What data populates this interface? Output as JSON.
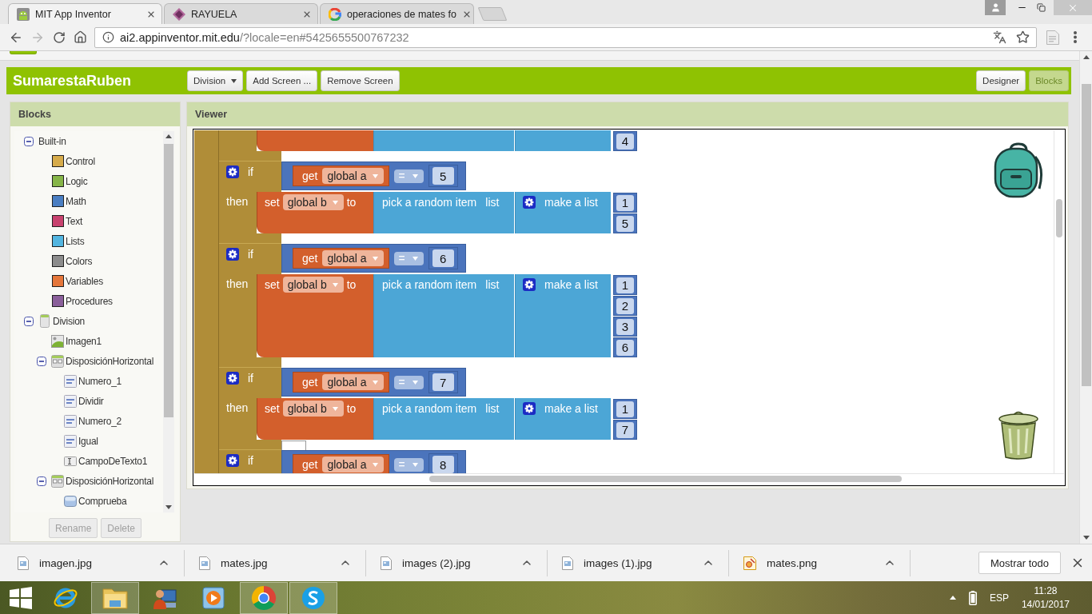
{
  "browser": {
    "tabs": [
      {
        "title": "MIT App Inventor",
        "kind": "app",
        "selected": true
      },
      {
        "title": "RAYUELA",
        "kind": "site",
        "selected": false
      },
      {
        "title": "operaciones de mates fo",
        "kind": "search",
        "selected": false
      }
    ],
    "address": {
      "host": "ai2.appinventor.mit.edu",
      "path": "/?locale=en#5425655500767232"
    }
  },
  "app": {
    "project_title": "SumarestaRuben",
    "screen_dropdown": "Division",
    "screen_buttons": [
      "Add Screen ...",
      "Remove Screen"
    ],
    "view_buttons": [
      {
        "label": "Designer",
        "selected": false
      },
      {
        "label": "Blocks",
        "selected": true
      }
    ]
  },
  "blocks_panel": {
    "title": "Blocks",
    "tree": [
      {
        "label": "Built-in",
        "kind": "group",
        "expanded": true,
        "children": [
          {
            "label": "Control",
            "kind": "category",
            "color": "#d6ab4a"
          },
          {
            "label": "Logic",
            "kind": "category",
            "color": "#86b548"
          },
          {
            "label": "Math",
            "kind": "category",
            "color": "#4a7ec2"
          },
          {
            "label": "Text",
            "kind": "category",
            "color": "#c8426e"
          },
          {
            "label": "Lists",
            "kind": "category",
            "color": "#52b5e0"
          },
          {
            "label": "Colors",
            "kind": "category",
            "color": "#8c8c8c"
          },
          {
            "label": "Variables",
            "kind": "category",
            "color": "#e5763a"
          },
          {
            "label": "Procedures",
            "kind": "category",
            "color": "#8a5f9a"
          }
        ]
      },
      {
        "label": "Division",
        "kind": "screen",
        "expanded": true,
        "children": [
          {
            "label": "Imagen1",
            "kind": "image"
          },
          {
            "label": "DisposiciónHorizontal",
            "kind": "arrangement",
            "expanded": true,
            "children": [
              {
                "label": "Numero_1",
                "kind": "label"
              },
              {
                "label": "Dividir",
                "kind": "label"
              },
              {
                "label": "Numero_2",
                "kind": "label"
              },
              {
                "label": "Igual",
                "kind": "label"
              },
              {
                "label": "CampoDeTexto1",
                "kind": "textbox"
              }
            ]
          },
          {
            "label": "DisposiciónHorizontal",
            "kind": "arrangement",
            "expanded": true,
            "children": [
              {
                "label": "Comprueba",
                "kind": "button"
              }
            ]
          }
        ]
      }
    ],
    "buttons": [
      {
        "label": "Rename",
        "disabled": true
      },
      {
        "label": "Delete",
        "disabled": true
      }
    ]
  },
  "viewer": {
    "title": "Viewer",
    "cut_off_block": {
      "items": [
        "4"
      ]
    },
    "if_blocks": [
      {
        "if_label": "if",
        "condition": {
          "get": "get",
          "variable": "global a",
          "operator": "=",
          "value": "5"
        },
        "then_label": "then",
        "action": {
          "set": "set",
          "variable": "global b",
          "to": "to",
          "pick": "pick a random item",
          "list": "list",
          "make": "make a list",
          "items": [
            "1",
            "5"
          ]
        }
      },
      {
        "if_label": "if",
        "condition": {
          "get": "get",
          "variable": "global a",
          "operator": "=",
          "value": "6"
        },
        "then_label": "then",
        "action": {
          "set": "set",
          "variable": "global b",
          "to": "to",
          "pick": "pick a random item",
          "list": "list",
          "make": "make a list",
          "items": [
            "1",
            "2",
            "3",
            "6"
          ]
        }
      },
      {
        "if_label": "if",
        "condition": {
          "get": "get",
          "variable": "global a",
          "operator": "=",
          "value": "7"
        },
        "then_label": "then",
        "action": {
          "set": "set",
          "variable": "global b",
          "to": "to",
          "pick": "pick a random item",
          "list": "list",
          "make": "make a list",
          "items": [
            "1",
            "7"
          ]
        }
      },
      {
        "if_label": "if",
        "condition": {
          "get": "get",
          "variable": "global a",
          "operator": "=",
          "value": "8"
        }
      }
    ]
  },
  "downloads": {
    "items": [
      {
        "name": "imagen.jpg",
        "kind": "image"
      },
      {
        "name": "mates.jpg",
        "kind": "image"
      },
      {
        "name": "images (2).jpg",
        "kind": "image"
      },
      {
        "name": "images (1).jpg",
        "kind": "image"
      },
      {
        "name": "mates.png",
        "kind": "drawing"
      }
    ],
    "show_all": "Mostrar todo"
  },
  "taskbar": {
    "apps": [
      {
        "kind": "orbit",
        "running": false
      },
      {
        "kind": "folder",
        "running": true
      },
      {
        "kind": "user",
        "running": false
      },
      {
        "kind": "media",
        "running": false
      },
      {
        "kind": "wheel",
        "running": true
      },
      {
        "kind": "chat",
        "running": true
      }
    ],
    "language": "ESP",
    "time": "11:28",
    "date": "14/01/2017"
  }
}
